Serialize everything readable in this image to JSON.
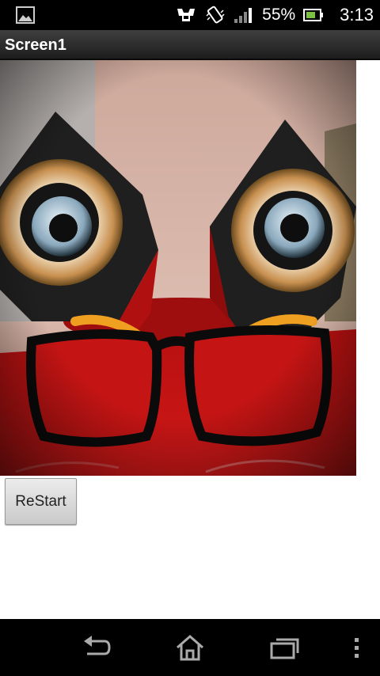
{
  "status_bar": {
    "battery_percent": "55%",
    "time": "3:13",
    "icons": [
      "gallery-notification-icon",
      "usb-debug-icon",
      "vibrate-icon",
      "signal-icon",
      "battery-icon"
    ]
  },
  "app": {
    "title": "Screen1"
  },
  "main": {
    "restart_label": "ReStart"
  },
  "nav_bar": {
    "icons": [
      "back-icon",
      "home-icon",
      "recent-apps-icon",
      "overflow-menu-icon"
    ]
  }
}
